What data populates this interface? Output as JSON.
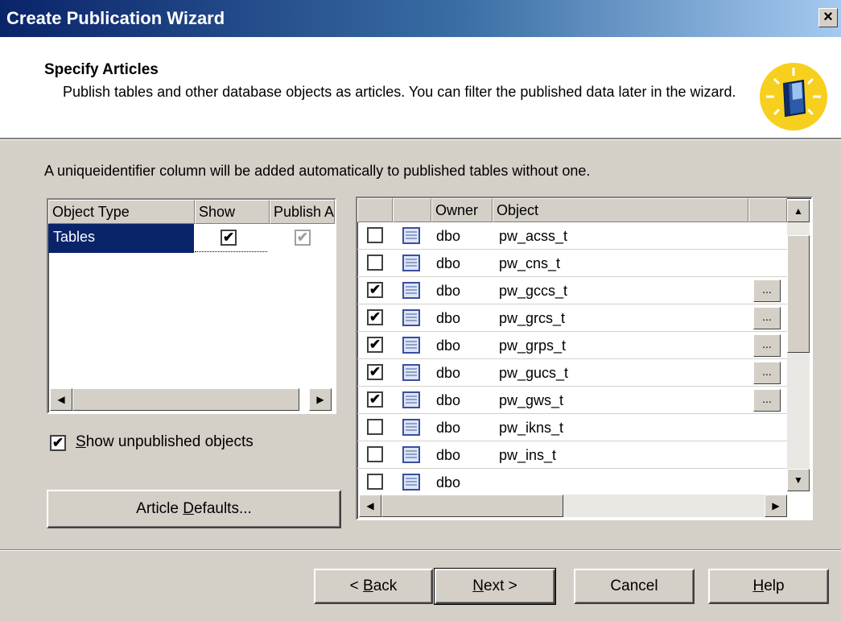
{
  "window": {
    "title": "Create Publication Wizard",
    "close_glyph": "×"
  },
  "header": {
    "title": "Specify Articles",
    "description": "Publish tables and other database objects as articles. You can filter the published data later in the wizard."
  },
  "info_text": "A uniqueidentifier column will be added automatically to published tables without one.",
  "object_types": {
    "columns": [
      "Object Type",
      "Show",
      "Publish A"
    ],
    "rows": [
      {
        "type": "Tables",
        "show": true,
        "publish_all": true
      }
    ]
  },
  "articles": {
    "columns": [
      "",
      "",
      "Owner",
      "Object",
      ""
    ],
    "rows": [
      {
        "checked": false,
        "owner": "dbo",
        "object": "pw_acss_t",
        "has_properties": false
      },
      {
        "checked": false,
        "owner": "dbo",
        "object": "pw_cns_t",
        "has_properties": false
      },
      {
        "checked": true,
        "owner": "dbo",
        "object": "pw_gccs_t",
        "has_properties": true
      },
      {
        "checked": true,
        "owner": "dbo",
        "object": "pw_grcs_t",
        "has_properties": true
      },
      {
        "checked": true,
        "owner": "dbo",
        "object": "pw_grps_t",
        "has_properties": true
      },
      {
        "checked": true,
        "owner": "dbo",
        "object": "pw_gucs_t",
        "has_properties": true
      },
      {
        "checked": true,
        "owner": "dbo",
        "object": "pw_gws_t",
        "has_properties": true
      },
      {
        "checked": false,
        "owner": "dbo",
        "object": "pw_ikns_t",
        "has_properties": false
      },
      {
        "checked": false,
        "owner": "dbo",
        "object": "pw_ins_t",
        "has_properties": false
      },
      {
        "checked": false,
        "owner": "dbo",
        "object": "",
        "has_properties": false
      }
    ],
    "ellipsis_label": "..."
  },
  "show_unpublished": {
    "checked": true,
    "label_prefix": "",
    "accel": "S",
    "label_rest": "how unpublished objects"
  },
  "article_defaults": {
    "prefix": "Article ",
    "accel": "D",
    "rest": "efaults..."
  },
  "buttons": {
    "back": {
      "prefix": "< ",
      "accel": "B",
      "rest": "ack"
    },
    "next": {
      "prefix": "",
      "accel": "N",
      "rest": "ext >"
    },
    "cancel": "Cancel",
    "help": {
      "prefix": "",
      "accel": "H",
      "rest": "elp"
    }
  },
  "glyphs": {
    "check": "✔",
    "arrow_left": "◀",
    "arrow_right": "▶",
    "arrow_up": "▲",
    "arrow_down": "▼"
  },
  "icons": {
    "wizard": "book-lightbulb-icon",
    "table": "table-icon"
  },
  "colors": {
    "titlebar": "#0a246a",
    "selection": "#0a246a",
    "face": "#d4d0c8",
    "wizard_icon": "#f7cf1e"
  }
}
